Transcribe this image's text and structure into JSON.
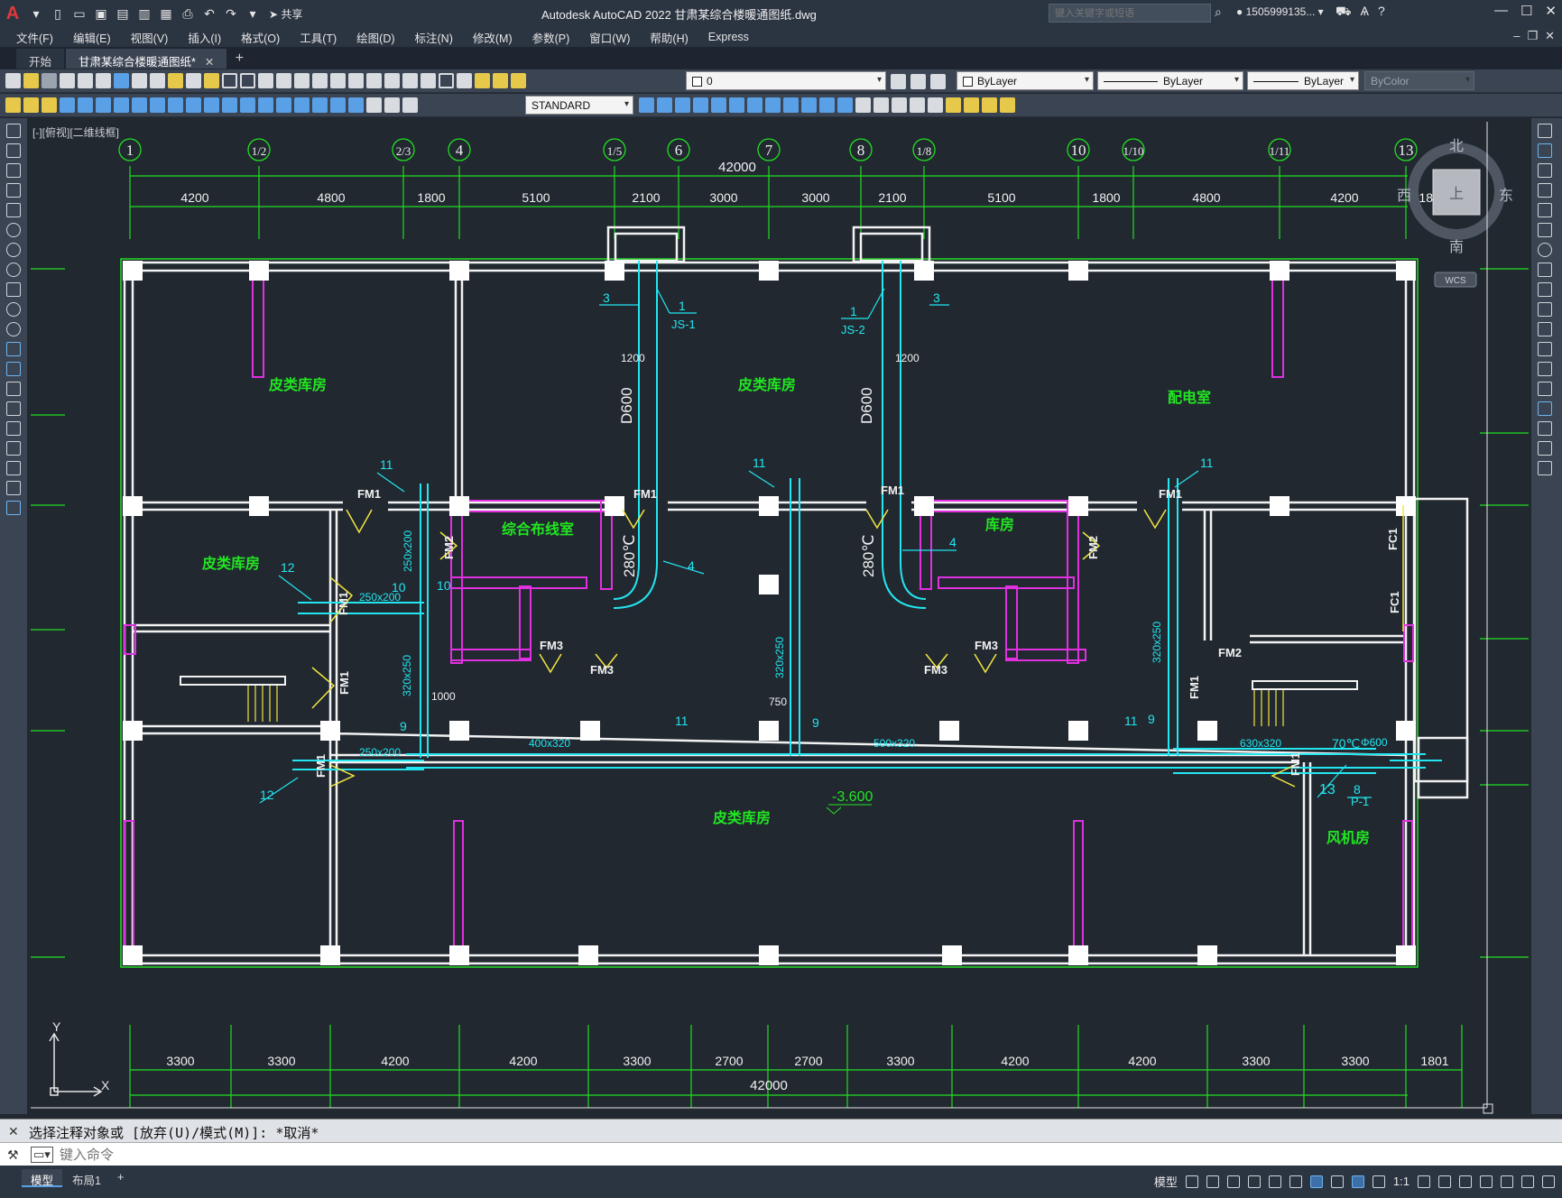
{
  "titlebar": {
    "app_title": "Autodesk AutoCAD 2022    甘肃某综合楼暖通图纸.dwg",
    "share_label": "共享",
    "search_placeholder": "键入关键字或短语",
    "user": "1505999135..."
  },
  "menu": [
    "文件(F)",
    "编辑(E)",
    "视图(V)",
    "插入(I)",
    "格式(O)",
    "工具(T)",
    "绘图(D)",
    "标注(N)",
    "修改(M)",
    "参数(P)",
    "窗口(W)",
    "帮助(H)",
    "Express"
  ],
  "tabs": [
    {
      "label": "开始",
      "active": false
    },
    {
      "label": "甘肃某综合楼暖通图纸*",
      "active": true
    }
  ],
  "toolbar": {
    "layer": "0",
    "color": "ByLayer",
    "linetype": "ByLayer",
    "lineweight": "ByLayer",
    "plotstyle": "ByColor",
    "textstyle": "STANDARD"
  },
  "view_label": "[-][俯视][二维线框]",
  "viewcube": {
    "north": "北",
    "south": "南",
    "east": "东",
    "west": "西",
    "top": "上",
    "wcs": "WCS"
  },
  "drawing": {
    "top_axes": [
      "1",
      "1/2",
      "2/3",
      "4",
      "1/5",
      "6",
      "7",
      "8",
      "1/8",
      "10",
      "1/10",
      "1/11",
      "13"
    ],
    "top_total": "42000",
    "top_dims": [
      "4200",
      "4800",
      "1800",
      "5100",
      "2100",
      "3000",
      "3000",
      "2100",
      "5100",
      "1800",
      "4800",
      "4200",
      "1800"
    ],
    "bottom_dims": [
      "3300",
      "3300",
      "4200",
      "4200",
      "3300",
      "2700",
      "2700",
      "3300",
      "4200",
      "4200",
      "3300",
      "3300",
      "1801"
    ],
    "bottom_total": "42000",
    "rooms": [
      {
        "label": "皮类库房"
      },
      {
        "label": "皮类库房"
      },
      {
        "label": "配电室"
      },
      {
        "label": "综合布线室"
      },
      {
        "label": "库房"
      },
      {
        "label": "皮类库房"
      },
      {
        "label": "皮类库房"
      },
      {
        "label": "风机房"
      }
    ],
    "annotations": {
      "d600": "D600",
      "temp280": "280℃",
      "js1": "JS-1",
      "js2": "JS-2",
      "n1200": "1200",
      "fm1": "FM1",
      "fm2": "FM2",
      "fm3": "FM3",
      "fc1": "FC1",
      "duct400": "400x320",
      "duct500": "500x320",
      "duct630": "630x320",
      "duct250": "250x200",
      "duct320": "320x250",
      "n1000": "1000",
      "n750": "750",
      "temp70": "70℃",
      "phi600": "Φ600",
      "p1": "P-1",
      "elev": "-3.600",
      "tag1": "1",
      "tag3": "3",
      "tag4": "4",
      "tag8": "8",
      "tag9": "9",
      "tag10": "10",
      "tag11": "11",
      "tag12": "12",
      "tag13": "13"
    }
  },
  "command": {
    "history": "选择注释对象或 [放弃(U)/模式(M)]: *取消*",
    "placeholder": "键入命令"
  },
  "status": {
    "layout_tabs": [
      "模型",
      "布局1"
    ],
    "model_label": "模型",
    "scale": "1:1"
  },
  "colors": {
    "background": "#212830",
    "axis_green": "#22dd22",
    "wall_white": "#f2f2f2",
    "duct_cyan": "#22e6f0",
    "partition_magenta": "#e030e0",
    "text_yellow": "#f2e640",
    "room_label_green": "#22e622"
  }
}
